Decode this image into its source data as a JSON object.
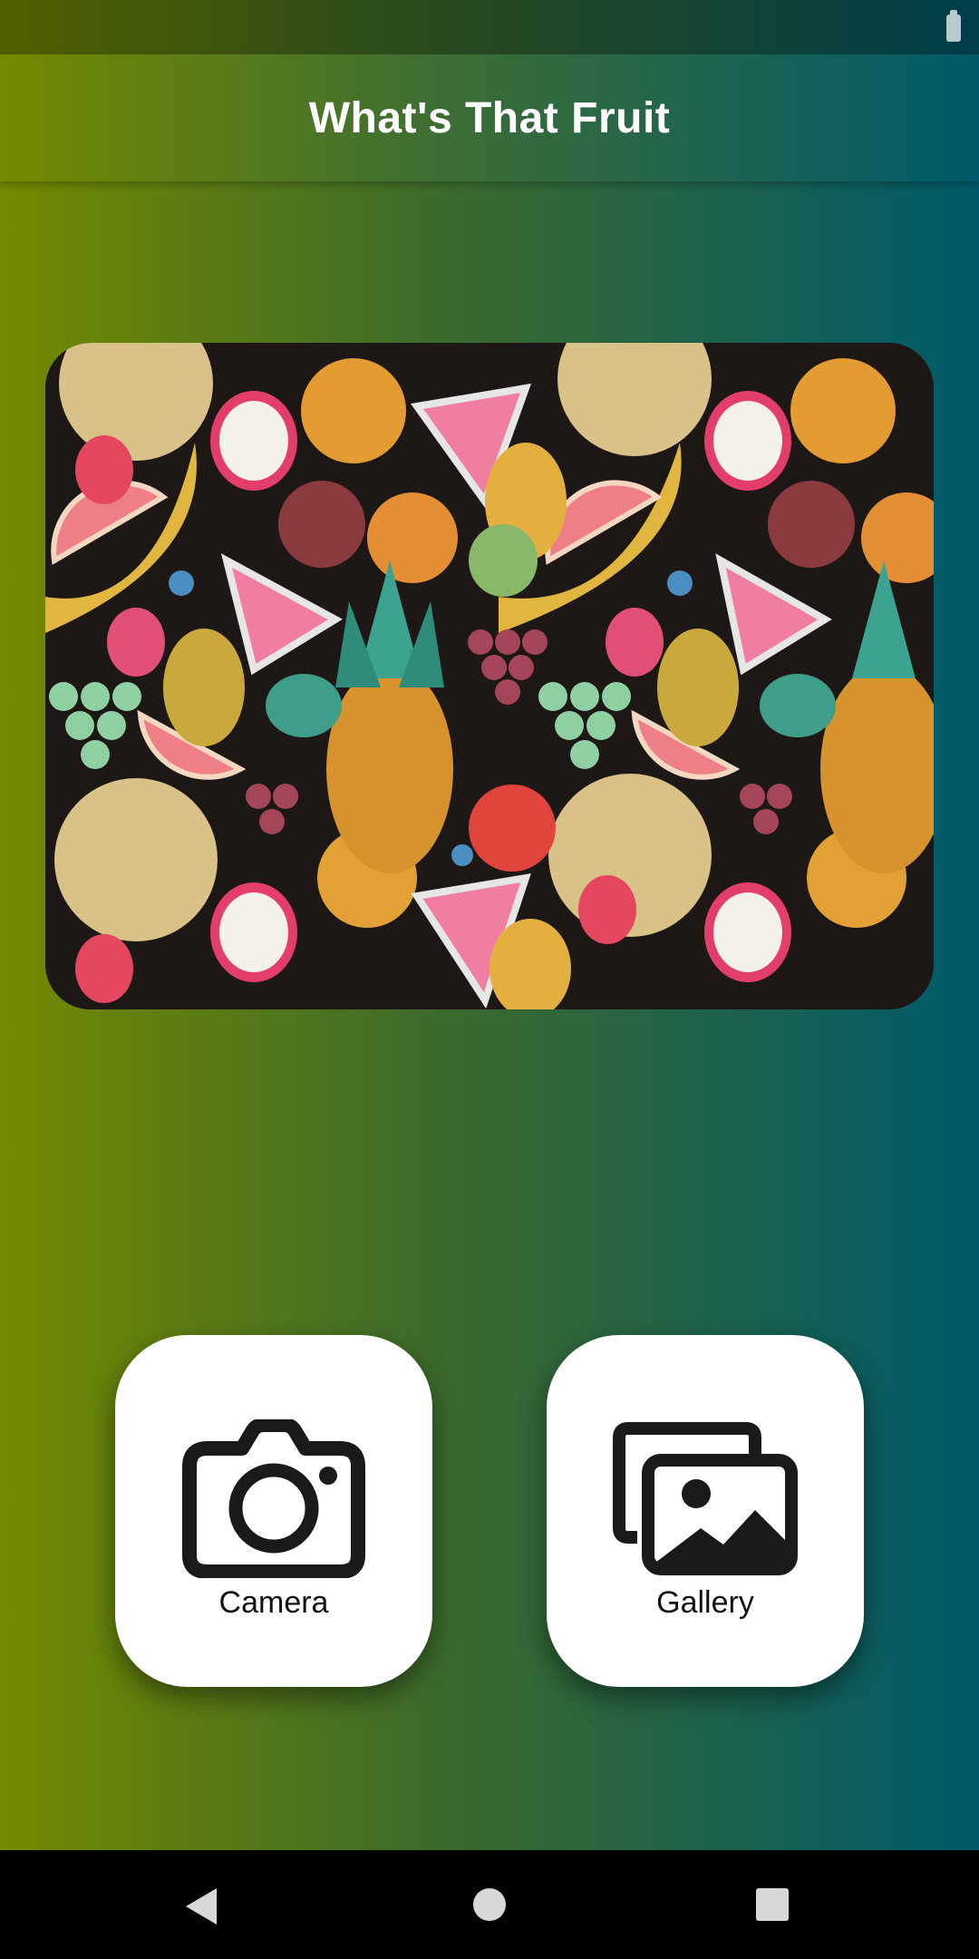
{
  "app": {
    "title": "What's That Fruit"
  },
  "hero_image": {
    "icon": "fruit-pattern-image"
  },
  "actions": {
    "camera_label": "Camera",
    "gallery_label": "Gallery",
    "camera_icon": "camera-icon",
    "gallery_icon": "gallery-icon"
  },
  "colors": {
    "gradient_left": "#748a00",
    "gradient_mid": "#3c6a2c",
    "gradient_right": "#005a6b",
    "button_bg": "#ffffff"
  }
}
